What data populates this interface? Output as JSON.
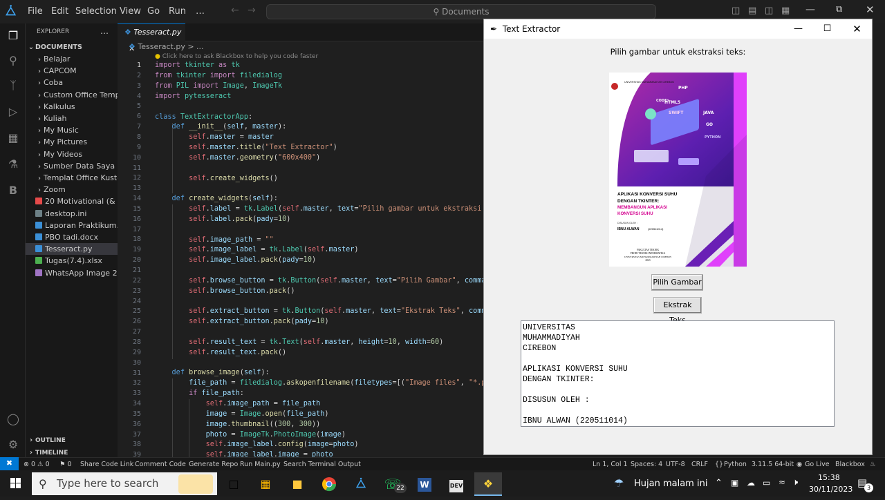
{
  "titlebar": {
    "menu": [
      "File",
      "Edit",
      "Selection",
      "View",
      "Go",
      "Run",
      "…"
    ],
    "search_placeholder": "Documents"
  },
  "explorer": {
    "header": "EXPLORER",
    "more": "…",
    "section": "DOCUMENTS",
    "items": [
      {
        "label": "Belajar",
        "type": "folder"
      },
      {
        "label": "CAPCOM",
        "type": "folder"
      },
      {
        "label": "Coba",
        "type": "folder"
      },
      {
        "label": "Custom Office Templa...",
        "type": "folder"
      },
      {
        "label": "Kalkulus",
        "type": "folder"
      },
      {
        "label": "Kuliah",
        "type": "folder"
      },
      {
        "label": "My Music",
        "type": "folder"
      },
      {
        "label": "My Pictures",
        "type": "folder"
      },
      {
        "label": "My Videos",
        "type": "folder"
      },
      {
        "label": "Sumber Data Saya",
        "type": "folder"
      },
      {
        "label": "Templat Office Kustom",
        "type": "folder"
      },
      {
        "label": "Zoom",
        "type": "folder"
      },
      {
        "label": "20 Motivational (& Fr...",
        "type": "pdf"
      },
      {
        "label": "desktop.ini",
        "type": "ini"
      },
      {
        "label": "Laporan Praktikum.do...",
        "type": "docx"
      },
      {
        "label": "PBO tadi.docx",
        "type": "docx"
      },
      {
        "label": "Tesseract.py",
        "type": "py"
      },
      {
        "label": "Tugas(7.4).xlsx",
        "type": "xlsx"
      },
      {
        "label": "WhatsApp Image 202...",
        "type": "img"
      }
    ],
    "outline": "OUTLINE",
    "timeline": "TIMELINE"
  },
  "editor": {
    "tab_label": "Tesseract.py",
    "breadcrumb": "Tesseract.py > ...",
    "hint": "Click here to ask Blackbox to help you code faster",
    "line_numbers": [
      "1",
      "2",
      "3",
      "4",
      "5",
      "6",
      "7",
      "8",
      "9",
      "10",
      "11",
      "12",
      "13",
      "14",
      "15",
      "16",
      "17",
      "18",
      "19",
      "20",
      "21",
      "22",
      "23",
      "24",
      "25",
      "26",
      "27",
      "28",
      "29",
      "30",
      "31",
      "32",
      "33",
      "34",
      "35",
      "36",
      "37",
      "38",
      "39"
    ]
  },
  "statusbar": {
    "problems": "⊗ 0 ⚠ 0",
    "ports": "⚑ 0",
    "share": "Share Code Link",
    "comment": "Comment Code",
    "generate": "Generate Repo",
    "run": "Run Main.py",
    "search_terminal": "Search Terminal Output",
    "position": "Ln 1, Col 1",
    "spaces": "Spaces: 4",
    "encoding": "UTF-8",
    "eol": "CRLF",
    "language": "Python",
    "interpreter": "3.11.5 64-bit",
    "golive": "Go Live",
    "blackbox": "Blackbox"
  },
  "tk_window": {
    "title": "Text Extractor",
    "prompt": "Pilih gambar untuk ekstraksi teks:",
    "browse_button": "Pilih Gambar",
    "extract_button": "Ekstrak Teks",
    "result_text": "UNIVERSITAS\nMUHAMMADIYAH\nCIREBON\n\nAPLIKASI KONVERSI SUHU\nDENGAN TKINTER:\n\nDISUSUN OLEH :\n\nIBNU ALWAN (220511014)",
    "cover": {
      "uni": "UNIVERSITAS MUHAMMADIYAH CIREBON",
      "title1": "APLIKASI KONVERSI SUHU",
      "title2": "DENGAN TKINTER:",
      "subtitle1": "MEMBANGUN APLIKASI",
      "subtitle2": "KONVERSI SUHU",
      "by": "DISUSUN OLEH :",
      "author": "IBNU ALWAN",
      "nim": "(220511014)",
      "footer1": "FAKULTAS TEKNIK",
      "footer2": "PRODI TEKNIK INFORMATIKA",
      "footer3": "UNIVERSITAS MUHAMMADIYAH CIREBON",
      "footer4": "2023",
      "tags": [
        "HTML5",
        "SWIFT",
        "JAVA",
        "PHP",
        "GO",
        "PYTHON",
        "CODE>"
      ]
    }
  },
  "taskbar": {
    "search_placeholder": "Type here to search",
    "weather": "Hujan malam ini",
    "time": "15:38",
    "date": "30/11/2023",
    "whatsapp_badge": "22",
    "notif_badge": "3"
  },
  "colors": {
    "accent": "#0078d4",
    "editor_bg": "#1f1f1f",
    "cover_purple": "#6a1fb5",
    "cover_pink": "#e040fb"
  }
}
